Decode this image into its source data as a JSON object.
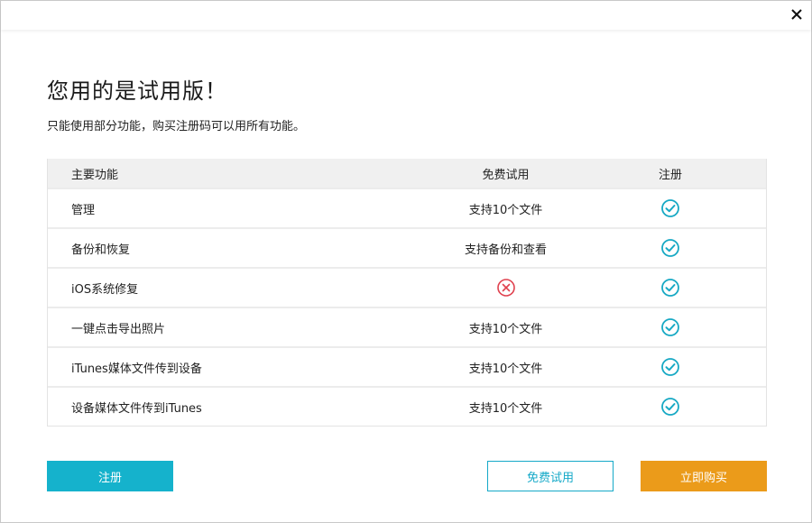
{
  "dialog": {
    "title": "您用的是试用版！",
    "subtitle": "只能使用部分功能，购买注册码可以用所有功能。"
  },
  "colors": {
    "accent": "#15b2cc",
    "buy": "#eb9b1a",
    "check": "#17a9c4",
    "cross": "#e0424f"
  },
  "table": {
    "headers": {
      "feature": "主要功能",
      "trial": "免费试用",
      "register": "注册"
    },
    "rows": [
      {
        "feature": "管理",
        "trial": "支持10个文件",
        "trial_icon": null,
        "register_icon": "check-circle-icon"
      },
      {
        "feature": "备份和恢复",
        "trial": "支持备份和查看",
        "trial_icon": null,
        "register_icon": "check-circle-icon"
      },
      {
        "feature": "iOS系统修复",
        "trial": "",
        "trial_icon": "cross-circle-icon",
        "register_icon": "check-circle-icon"
      },
      {
        "feature": "一键点击导出照片",
        "trial": "支持10个文件",
        "trial_icon": null,
        "register_icon": "check-circle-icon"
      },
      {
        "feature": "iTunes媒体文件传到设备",
        "trial": "支持10个文件",
        "trial_icon": null,
        "register_icon": "check-circle-icon"
      },
      {
        "feature": "设备媒体文件传到iTunes",
        "trial": "支持10个文件",
        "trial_icon": null,
        "register_icon": "check-circle-icon"
      }
    ]
  },
  "buttons": {
    "register": "注册",
    "free_trial": "免费试用",
    "buy_now": "立即购买"
  },
  "window": {
    "close_icon": "close-icon"
  }
}
